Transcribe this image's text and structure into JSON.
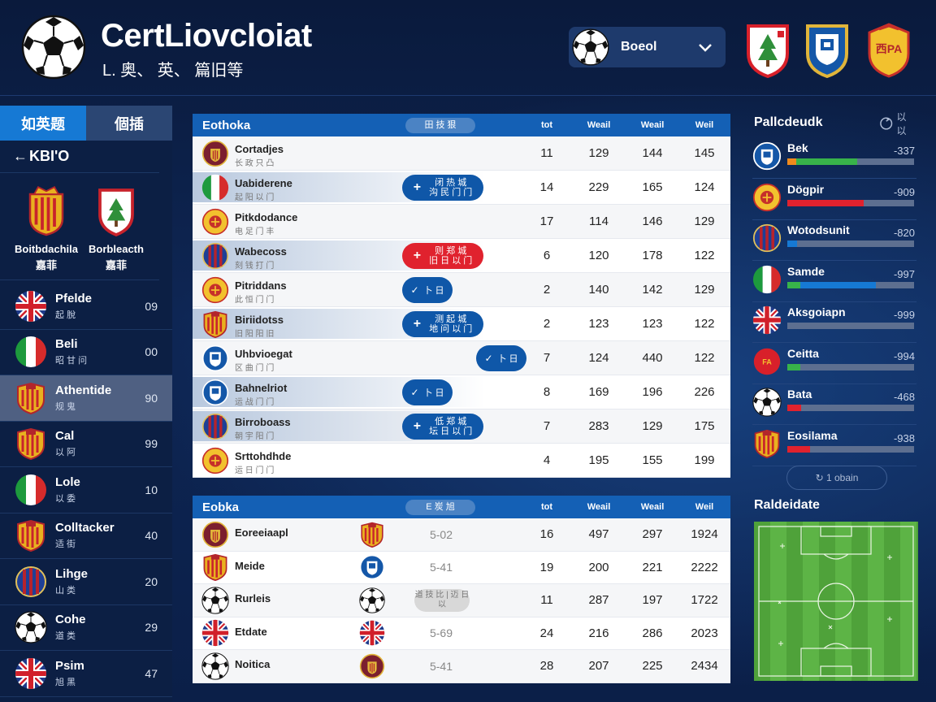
{
  "colors": {
    "accent": "#1679d4",
    "table_header": "#1460b5",
    "button_blue": "#0f57a8",
    "button_red": "#e0222e",
    "sidebar_selected": "#4f6082",
    "pitch_green": "#4fa23a"
  },
  "header": {
    "title": "CertLiovcloiat",
    "subtitle": "L. 奥、 英、 篇旧等",
    "selector": {
      "label": "Boeol",
      "icon": "soccer-ball-icon"
    },
    "crests": [
      "green-tree-crest-icon",
      "blue-white-crest-icon",
      "yellow-red-crest-icon"
    ]
  },
  "sidebar": {
    "tabs": [
      {
        "label": "如英题",
        "active": true
      },
      {
        "label": "個插",
        "active": false
      }
    ],
    "back_label": "KBI'O",
    "featured": [
      {
        "name": "Boitbdachila",
        "sub": "嘉菲",
        "icon": "barcelona-crest-icon"
      },
      {
        "name": "Borbleacth",
        "sub": "嘉菲",
        "icon": "tree-crest-icon"
      }
    ],
    "items": [
      {
        "title": "Pfelde",
        "sub": "起 脫",
        "num": "09",
        "icon": "uk-flag-icon"
      },
      {
        "title": "Beli",
        "sub": "昭 甘 问",
        "num": "00",
        "icon": "italy-flag-icon"
      },
      {
        "title": "Athentide",
        "sub": "规 鬼",
        "num": "90",
        "icon": "shield-crest-icon",
        "selected": true
      },
      {
        "title": "Cal",
        "sub": "以 阿",
        "num": "99",
        "icon": "shield-crest-icon"
      },
      {
        "title": "Lole",
        "sub": "以 委",
        "num": "10",
        "icon": "italy-flag-icon"
      },
      {
        "title": "Colltacker",
        "sub": "适 街",
        "num": "40",
        "icon": "shield-crest-icon"
      },
      {
        "title": "Lihge",
        "sub": "山 类",
        "num": "20",
        "icon": "striped-crest-icon"
      },
      {
        "title": "Cohe",
        "sub": "道 类",
        "num": "29",
        "icon": "soccer-ball-icon"
      },
      {
        "title": "Psim",
        "sub": "旭 黑",
        "num": "47",
        "icon": "uk-flag-icon"
      }
    ]
  },
  "table1": {
    "title": "Eothoka",
    "pill": "田 技 狠",
    "columns": [
      "tot",
      "Weail",
      "Weail",
      "Weil"
    ],
    "rows": [
      {
        "name": "Cortadjes",
        "sub": "长 政 只 凸",
        "icon": "maroon-crest-icon",
        "v": [
          "11",
          "129",
          "144",
          "145"
        ],
        "button": null,
        "highlight": false
      },
      {
        "name": "Uabiderene",
        "sub": "起 阳 以 门",
        "icon": "italy-flag-icon",
        "v": [
          "14",
          "229",
          "165",
          "124"
        ],
        "button": {
          "style": "blue",
          "plus": true,
          "l1": "闭 热 城",
          "l2": "沟 民 门 门"
        },
        "highlight": true
      },
      {
        "name": "Pitkdodance",
        "sub": "电 足 门 丰",
        "icon": "yellow-crest-icon",
        "v": [
          "17",
          "114",
          "146",
          "129"
        ],
        "button": null,
        "highlight": false
      },
      {
        "name": "Wabecoss",
        "sub": "刻 钱 打 门",
        "icon": "striped-crest-icon",
        "v": [
          "6",
          "120",
          "178",
          "122"
        ],
        "button": {
          "style": "red",
          "plus": true,
          "l1": "则 郑 城",
          "l2": "旧 日 以 门"
        },
        "highlight": true
      },
      {
        "name": "Pitriddans",
        "sub": "此 恒 门 门",
        "icon": "yellow-crest-icon",
        "v": [
          "2",
          "140",
          "142",
          "129"
        ],
        "button": {
          "style": "blue",
          "plus": false,
          "l1": "卜 日",
          "l2": ""
        },
        "highlight": false
      },
      {
        "name": "Biriidotss",
        "sub": "旧 阳 阳 旧",
        "icon": "shield-crest-icon",
        "v": [
          "2",
          "123",
          "123",
          "122"
        ],
        "button": {
          "style": "blue",
          "plus": true,
          "l1": "测 起 城",
          "l2": "地 问 以 门"
        },
        "highlight": true
      },
      {
        "name": "Uhbvioegat",
        "sub": "区 曲 门 门",
        "icon": "blue-white-crest-icon",
        "v": [
          "7",
          "124",
          "440",
          "122"
        ],
        "button": {
          "style": "blue-right",
          "plus": false,
          "l1": "卜 日",
          "l2": ""
        },
        "highlight": false
      },
      {
        "name": "Bahnelriot",
        "sub": "运 战 门 门",
        "icon": "blue-white-crest-icon",
        "v": [
          "8",
          "169",
          "196",
          "226"
        ],
        "button": {
          "style": "blue",
          "plus": false,
          "l1": "卜 日",
          "l2": ""
        },
        "highlight": true
      },
      {
        "name": "Birroboass",
        "sub": "朝 宇 阳 门",
        "icon": "striped-crest-icon",
        "v": [
          "7",
          "283",
          "129",
          "175"
        ],
        "button": {
          "style": "blue",
          "plus": true,
          "l1": "低 郑 城",
          "l2": "坛 日 以 门"
        },
        "highlight": true
      },
      {
        "name": "Srttohdhde",
        "sub": "运 日 门 门",
        "icon": "yellow-crest-icon",
        "v": [
          "4",
          "195",
          "155",
          "199"
        ],
        "button": null,
        "highlight": false
      }
    ]
  },
  "table2": {
    "title": "Eobka",
    "pill": "E 炭 旭",
    "columns": [
      "tot",
      "Weail",
      "Weail",
      "Weil"
    ],
    "rows": [
      {
        "name": "Eoreeiaapl",
        "icon": "maroon-crest-icon",
        "icon2": "shield-crest-icon",
        "mid": "5-02",
        "v": [
          "16",
          "497",
          "297",
          "1924"
        ]
      },
      {
        "name": "Meide",
        "icon": "shield-crest-icon",
        "icon2": "blue-white-crest-icon",
        "mid": "5-41",
        "v": [
          "19",
          "200",
          "221",
          "2222"
        ]
      },
      {
        "name": "Rurleis",
        "icon": "soccer-ball-icon",
        "icon2": "soccer-ball-icon",
        "mid": "",
        "pill": "道 技 比 | 迈 日 以",
        "v": [
          "11",
          "287",
          "197",
          "1722"
        ]
      },
      {
        "name": "Etdate",
        "icon": "uk-flag-icon",
        "icon2": "uk-flag-icon",
        "mid": "5-69",
        "v": [
          "24",
          "216",
          "286",
          "2023"
        ]
      },
      {
        "name": "Noitica",
        "icon": "soccer-ball-icon",
        "icon2": "maroon-crest-icon",
        "mid": "5-41",
        "v": [
          "28",
          "207",
          "225",
          "2434"
        ]
      }
    ]
  },
  "right_panel": {
    "title": "Pallcdeudk",
    "title_icon_label": "以 以",
    "items": [
      {
        "name": "Bek",
        "val": "-337",
        "icon": "blue-white-crest-icon",
        "segs": [
          {
            "w": 0.07,
            "c": "#f08a1c"
          },
          {
            "w": 0.48,
            "c": "#38b34a"
          }
        ]
      },
      {
        "name": "Dögpir",
        "val": "-909",
        "icon": "yellow-crest-icon",
        "segs": [
          {
            "w": 0.6,
            "c": "#e0222e"
          }
        ]
      },
      {
        "name": "Wotodsunit",
        "val": "-820",
        "icon": "striped-crest-icon",
        "segs": [
          {
            "w": 0.08,
            "c": "#1679d4"
          }
        ]
      },
      {
        "name": "Samde",
        "val": "-997",
        "icon": "italy-flag-icon",
        "segs": [
          {
            "w": 0.1,
            "c": "#38b34a"
          },
          {
            "w": 0.6,
            "c": "#1679d4"
          }
        ]
      },
      {
        "name": "Aksgoiapn",
        "val": "-999",
        "icon": "uk-flag-icon",
        "segs": []
      },
      {
        "name": "Ceitta",
        "val": "-994",
        "icon": "red-round-crest-icon",
        "segs": [
          {
            "w": 0.1,
            "c": "#38b34a"
          }
        ]
      },
      {
        "name": "Bata",
        "val": "-468",
        "icon": "soccer-ball-icon",
        "segs": [
          {
            "w": 0.11,
            "c": "#e0222e"
          }
        ]
      },
      {
        "name": "Eosilama",
        "val": "-938",
        "icon": "shield-crest-icon",
        "segs": [
          {
            "w": 0.18,
            "c": "#e0222e"
          }
        ]
      }
    ],
    "more_button": "↻ 1 obain",
    "pitch_title": "Raldeidate"
  }
}
